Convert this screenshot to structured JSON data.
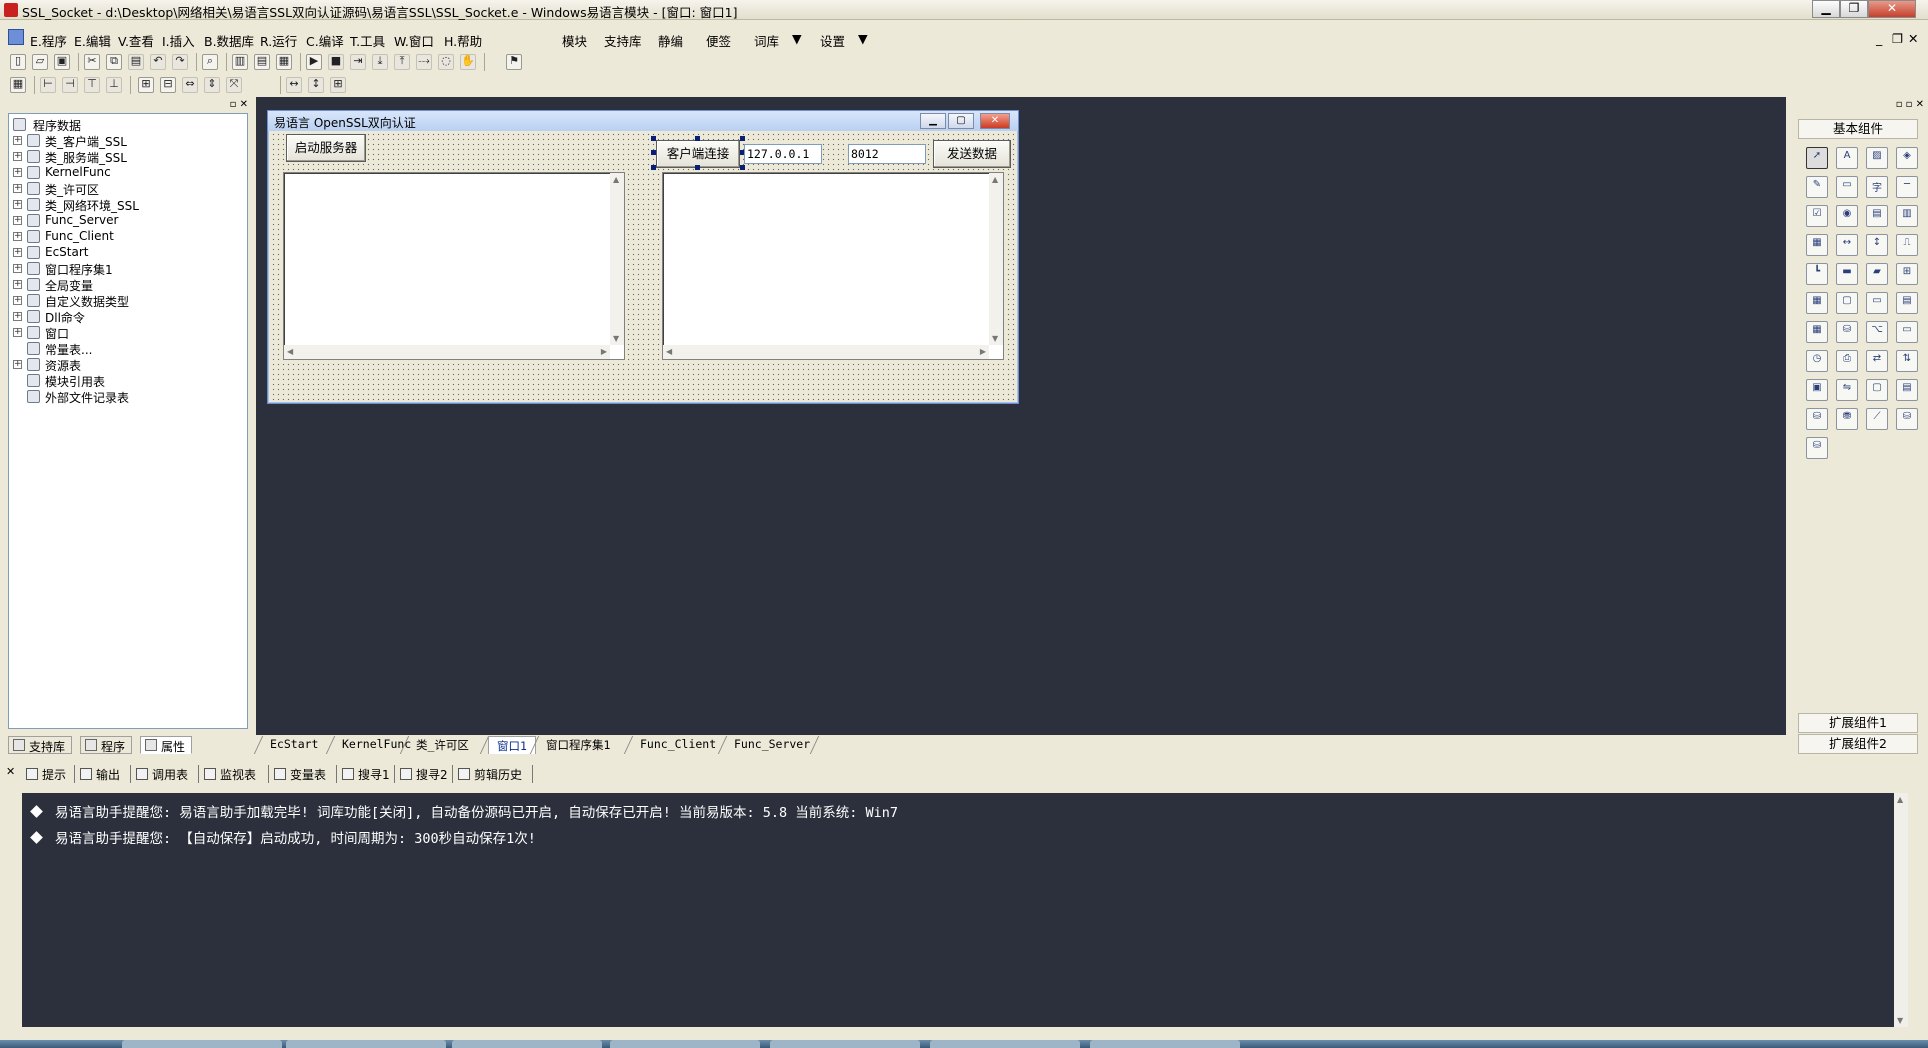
{
  "window": {
    "title": "SSL_Socket - d:\\Desktop\\网络相关\\易语言SSL双向认证源码\\易语言SSL\\SSL_Socket.e - Windows易语言模块 - [窗口: 窗口1]",
    "minimize": "▁",
    "restore": "❐",
    "close": "✕"
  },
  "menu": {
    "items": [
      "E.程序",
      "E.编辑",
      "V.查看",
      "I.插入",
      "B.数据库",
      "R.运行",
      "C.编译",
      "T.工具",
      "W.窗口",
      "H.帮助"
    ],
    "extra": [
      "模块",
      "支持库",
      "静编",
      "便签",
      "词库",
      "设置"
    ]
  },
  "toolbar": {
    "icons": [
      "new-file-icon",
      "open-icon",
      "save-icon",
      "cut-icon",
      "copy-icon",
      "paste-icon",
      "undo-icon",
      "redo-icon",
      "find-icon",
      "layout-icon",
      "run-icon",
      "stop-icon",
      "step-icon",
      "debug-icon"
    ],
    "layout_icons": [
      "align-left-icon",
      "align-center-icon",
      "align-right-icon",
      "same-width-icon",
      "same-height-icon",
      "grid-icon"
    ]
  },
  "tree": {
    "root": "程序数据",
    "items": [
      {
        "label": "类_客户端_SSL",
        "icon": "class-icon",
        "expand": true
      },
      {
        "label": "类_服务端_SSL",
        "icon": "class-icon",
        "expand": true
      },
      {
        "label": "KernelFunc",
        "icon": "module-icon",
        "expand": true
      },
      {
        "label": "类_许可区",
        "icon": "class-icon",
        "expand": true
      },
      {
        "label": "类_网络环境_SSL",
        "icon": "class-icon",
        "expand": true
      },
      {
        "label": "Func_Server",
        "icon": "module-icon",
        "expand": true
      },
      {
        "label": "Func_Client",
        "icon": "module-icon",
        "expand": true
      },
      {
        "label": "EcStart",
        "icon": "module-icon",
        "expand": true
      },
      {
        "label": "窗口程序集1",
        "icon": "module-icon",
        "expand": true
      },
      {
        "label": "全局变量",
        "icon": "variable-icon",
        "expand": true
      },
      {
        "label": "自定义数据类型",
        "icon": "type-icon",
        "expand": true
      },
      {
        "label": "Dll命令",
        "icon": "dll-icon",
        "expand": true
      },
      {
        "label": "窗口",
        "icon": "window-icon",
        "expand": true
      },
      {
        "label": "常量表...",
        "icon": "constant-icon",
        "expand": false
      },
      {
        "label": "资源表",
        "icon": "resource-icon",
        "expand": true
      },
      {
        "label": "模块引用表",
        "icon": "module-ref-icon",
        "expand": false
      },
      {
        "label": "外部文件记录表",
        "icon": "file-icon",
        "expand": false
      }
    ]
  },
  "left_tabs": [
    "支持库",
    "程序",
    "属性"
  ],
  "form": {
    "title": "易语言 OpenSSL双向认证",
    "start_server": "启动服务器",
    "client_connect": "客户端连接",
    "ip_value": "127.0.0.1",
    "port_value": "8012",
    "send_data": "发送数据"
  },
  "components": {
    "header": "基本组件",
    "extend1": "扩展组件1",
    "extend2": "扩展组件2",
    "icons": [
      "pointer-icon",
      "label-icon",
      "picture-icon",
      "shape-icon",
      "edit-icon",
      "frame-icon",
      "text-icon",
      "line-icon",
      "checkbox-icon",
      "radio-icon",
      "combo-icon",
      "list-icon",
      "listbox-icon",
      "scroll-h-icon",
      "scroll-v-icon",
      "slider-icon",
      "ruler-icon",
      "progress-icon",
      "bar-icon",
      "timer-box-icon",
      "grid-icon",
      "group-icon",
      "button-icon",
      "doc-icon",
      "calendar-icon",
      "db-icon",
      "tree-icon",
      "tab-icon",
      "clock-icon",
      "printer-icon",
      "net-client-icon",
      "net-server-icon",
      "network-icon",
      "transfer-icon",
      "window-icon",
      "table-icon",
      "data-source-icon",
      "db-provider-icon",
      "chart-icon",
      "odbc-icon",
      "odbc-db-icon"
    ]
  },
  "source_tabs": [
    "EcStart",
    "KernelFunc",
    "类_许可区",
    "窗口1",
    "窗口程序集1",
    "Func_Client",
    "Func_Server"
  ],
  "output_tabs": [
    "提示",
    "输出",
    "调用表",
    "监视表",
    "变量表",
    "搜寻1",
    "搜寻2",
    "剪辑历史"
  ],
  "output": {
    "lines": [
      "易语言助手提醒您:  易语言助手加载完毕!  词库功能[关闭], 自动备份源码已开启, 自动保存已开启!  当前易版本: 5.8  当前系统: Win7",
      "易语言助手提醒您: 【自动保存】启动成功, 时间周期为: 300秒自动保存1次!"
    ]
  },
  "colors": {
    "design_bg": "#2b303c",
    "output_bg": "#2b303c",
    "accent": "#0a2d8a"
  }
}
